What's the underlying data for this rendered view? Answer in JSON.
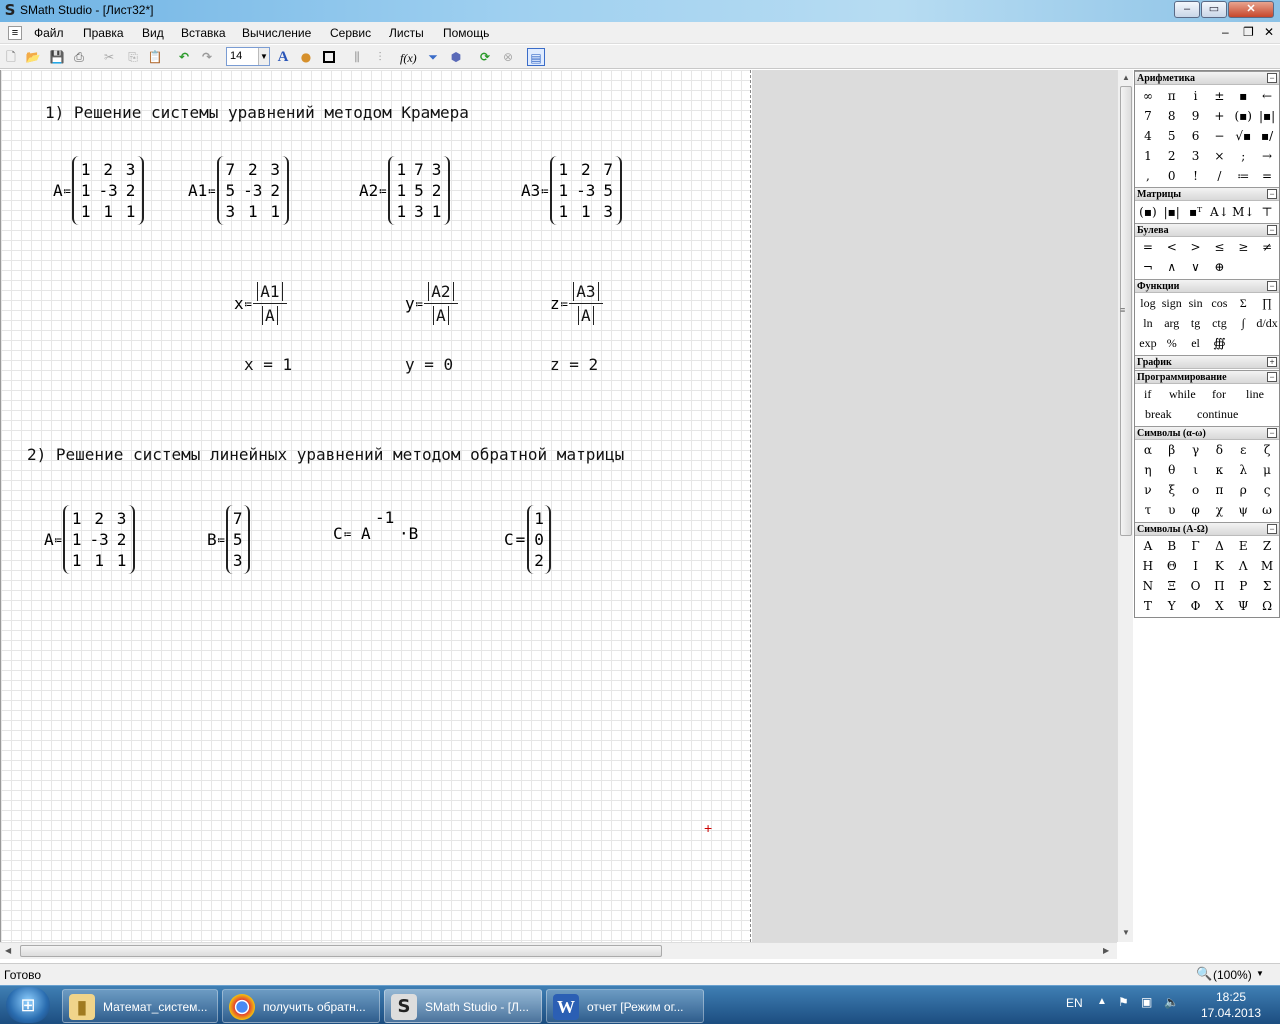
{
  "window": {
    "app_icon": "S",
    "title": "SMath Studio - [Лист32*]",
    "minimize": "–",
    "maximize": "▭",
    "close": "✕"
  },
  "menu": {
    "items": [
      "Файл",
      "Правка",
      "Вид",
      "Вставка",
      "Вычисление",
      "Сервис",
      "Листы",
      "Помощь"
    ],
    "doc_minimize": "–",
    "doc_restore": "❐",
    "doc_close": "✕"
  },
  "toolbar": {
    "font_size": "14",
    "fx_label": "f(x)"
  },
  "sheet": {
    "heading1": "1) Решение системы уравнений методом Крамера",
    "A_label": "A",
    "A1_label": "A1",
    "A2_label": "A2",
    "A3_label": "A3",
    "assign": "≔",
    "A_matrix": [
      [
        "1",
        "2",
        "3"
      ],
      [
        "1",
        "-3",
        "2"
      ],
      [
        "1",
        "1",
        "1"
      ]
    ],
    "A1_matrix": [
      [
        "7",
        "2",
        "3"
      ],
      [
        "5",
        "-3",
        "2"
      ],
      [
        "3",
        "1",
        "1"
      ]
    ],
    "A2_matrix": [
      [
        "1",
        "7",
        "3"
      ],
      [
        "1",
        "5",
        "2"
      ],
      [
        "1",
        "3",
        "1"
      ]
    ],
    "A3_matrix": [
      [
        "1",
        "2",
        "7"
      ],
      [
        "1",
        "-3",
        "5"
      ],
      [
        "1",
        "1",
        "3"
      ]
    ],
    "x_name": "x",
    "y_name": "y",
    "z_name": "z",
    "x_num": "A1",
    "y_num": "A2",
    "z_num": "A3",
    "den": "A",
    "x_result": "x = 1",
    "y_result": "y = 0",
    "z_result": "z = 2",
    "heading2": "2) Решение системы линейных уравнений методом обратной матрицы",
    "A2_name": "A",
    "eq": "=",
    "A_matrix_2": [
      [
        "1",
        "2",
        "3"
      ],
      [
        "1",
        "-3",
        "2"
      ],
      [
        "1",
        "1",
        "1"
      ]
    ],
    "B_name": "B",
    "B_vector": [
      "7",
      "5",
      "3"
    ],
    "C_def_left": "C",
    "C_def_A": "A",
    "C_def_exp": "-1",
    "C_def_B": "·B",
    "C_name": "C",
    "C_vector": [
      "1",
      "0",
      "2"
    ],
    "cursor": "+"
  },
  "panel": {
    "arithmetic": {
      "title": "Арифметика",
      "cells": [
        "∞",
        "π",
        "i",
        "±",
        "▪",
        "←",
        "7",
        "8",
        "9",
        "+",
        "(▪)",
        "|▪|",
        "4",
        "5",
        "6",
        "−",
        "√▪",
        "▪/",
        "1",
        "2",
        "3",
        "×",
        ";",
        "→",
        ",",
        "0",
        "!",
        "/",
        "≔",
        "="
      ]
    },
    "matrices": {
      "title": "Матрицы",
      "cells": [
        "(▪)",
        "|▪|",
        "▪ᵀ",
        "A↓",
        "M↓",
        "⊤"
      ]
    },
    "boolean": {
      "title": "Булева",
      "cells": [
        "=",
        "<",
        ">",
        "≤",
        "≥",
        "≠",
        "¬",
        "∧",
        "∨",
        "⊕",
        "",
        ""
      ]
    },
    "functions": {
      "title": "Функции",
      "cells": [
        "log",
        "sign",
        "sin",
        "cos",
        "Σ",
        "∏",
        "ln",
        "arg",
        "tg",
        "ctg",
        "∫",
        "d/dx",
        "exp",
        "%",
        "el",
        "∰",
        "",
        ""
      ]
    },
    "graph": {
      "title": "График"
    },
    "programming": {
      "title": "Программирование",
      "row1": [
        "if",
        "while",
        "for",
        "line"
      ],
      "row2": [
        "break",
        "continue"
      ]
    },
    "greek_lower": {
      "title": "Символы (α-ω)",
      "cells": [
        "α",
        "β",
        "γ",
        "δ",
        "ε",
        "ζ",
        "η",
        "θ",
        "ι",
        "κ",
        "λ",
        "μ",
        "ν",
        "ξ",
        "ο",
        "π",
        "ρ",
        "ς",
        "τ",
        "υ",
        "φ",
        "χ",
        "ψ",
        "ω"
      ]
    },
    "greek_upper": {
      "title": "Символы (Α-Ω)",
      "cells": [
        "Α",
        "Β",
        "Γ",
        "Δ",
        "Ε",
        "Ζ",
        "Η",
        "Θ",
        "Ι",
        "Κ",
        "Λ",
        "Μ",
        "Ν",
        "Ξ",
        "Ο",
        "Π",
        "Ρ",
        "Σ",
        "Τ",
        "Υ",
        "Φ",
        "Χ",
        "Ψ",
        "Ω"
      ]
    }
  },
  "status": {
    "text": "Готово",
    "zoom": "(100%)"
  },
  "taskbar": {
    "tasks": [
      {
        "label": "Математ_систем..."
      },
      {
        "label": "получить обратн..."
      },
      {
        "label": "SMath Studio - [Л..."
      },
      {
        "label": "отчет [Режим ог..."
      }
    ],
    "lang": "EN",
    "time": "18:25",
    "date": "17.04.2013"
  }
}
